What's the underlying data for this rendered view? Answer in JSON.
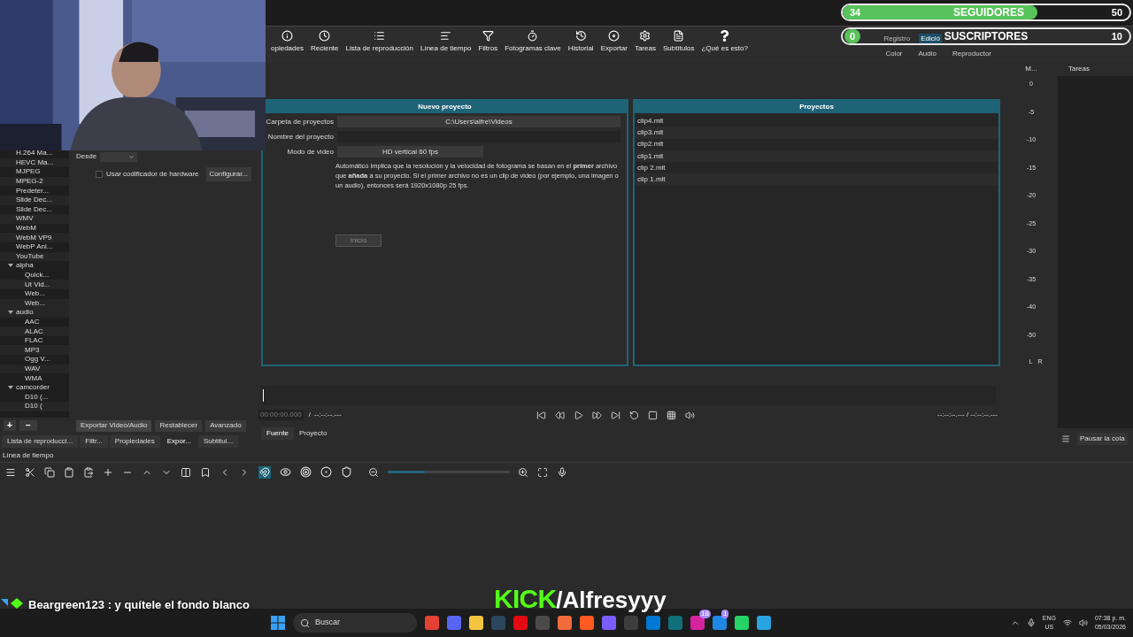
{
  "toolbar": [
    {
      "label": "opiedades"
    },
    {
      "label": "Reciente"
    },
    {
      "label": "Lista de reproducción"
    },
    {
      "label": "Línea de tiempo"
    },
    {
      "label": "Filtros"
    },
    {
      "label": "Fotogramas clave"
    },
    {
      "label": "Historial"
    },
    {
      "label": "Exportar"
    },
    {
      "label": "Tareas"
    },
    {
      "label": "Subtítulos"
    },
    {
      "label": "¿Qué es esto?"
    }
  ],
  "layouts": {
    "row1": [
      {
        "label": "Registro",
        "selected": false
      },
      {
        "label": "Edició",
        "selected": true
      }
    ],
    "row2": [
      {
        "label": "Color",
        "selected": false
      },
      {
        "label": "Audio",
        "selected": false
      },
      {
        "label": "Reproductor",
        "selected": false
      }
    ]
  },
  "export_presets": [
    {
      "label": "H.264 Ma..."
    },
    {
      "label": "HEVC Ma..."
    },
    {
      "label": "MJPEG"
    },
    {
      "label": "MPEG-2"
    },
    {
      "label": "Predeter..."
    },
    {
      "label": "Slide Dec..."
    },
    {
      "label": "Slide Dec..."
    },
    {
      "label": "WMV"
    },
    {
      "label": "WebM"
    },
    {
      "label": "WebM VP9"
    },
    {
      "label": "WebP Ani..."
    },
    {
      "label": "YouTube"
    },
    {
      "label": "alpha",
      "expanded": true,
      "children": [
        {
          "label": "Quick..."
        },
        {
          "label": "Ut Vid..."
        },
        {
          "label": "Web..."
        },
        {
          "label": "Web..."
        }
      ]
    },
    {
      "label": "audio",
      "expanded": true,
      "children": [
        {
          "label": "AAC"
        },
        {
          "label": "ALAC"
        },
        {
          "label": "FLAC"
        },
        {
          "label": "MP3"
        },
        {
          "label": "Ogg V..."
        },
        {
          "label": "WAV"
        },
        {
          "label": "WMA"
        }
      ]
    },
    {
      "label": "camcorder",
      "expanded": true,
      "children": [
        {
          "label": "D10 (..."
        },
        {
          "label": "D10 ("
        }
      ]
    }
  ],
  "export_settings": {
    "from_label": "Desde",
    "hardware_encoder": {
      "label": "Usar codificador de hardware",
      "checked": false
    },
    "configure_button": "Configurar...",
    "buttons": [
      "Exportar Video/Audio",
      "Restablecer",
      "Avanzado"
    ],
    "add": "+",
    "remove": "−"
  },
  "left_tabs": [
    {
      "label": "Lista de reproducci...",
      "selected": false
    },
    {
      "label": "Filtr...",
      "selected": false
    },
    {
      "label": "Propiedades",
      "selected": false
    },
    {
      "label": "Expor...",
      "selected": true
    },
    {
      "label": "Subtitul...",
      "selected": false
    }
  ],
  "new_project": {
    "title": "Nuevo proyecto",
    "folder_label": "Carpeta de proyectos",
    "folder": "C:\\Users\\alfre\\Videos",
    "name_label": "Nombre del proyecto",
    "mode_label": "Modo de video",
    "mode": "HD vertical 60 fps",
    "note": "Automático implica que la resolución y la velocidad de fotograma se basan en el **primer** archivo que **añada** a su proyecto. Si el primer archivo no es un clip de video (por ejemplo, una imagen o un audio), entonces será 1920x1080p 25 fps.",
    "start": {
      "label": "Inicio",
      "disabled": true
    }
  },
  "projects": {
    "title": "Proyectos",
    "items": [
      "clip4.mlt",
      "clip3.mlt",
      "clip2.mlt",
      "clip1.mlt",
      "clip 2.mlt",
      "clip 1.mlt"
    ]
  },
  "player": {
    "timecode": "00:00:00.000",
    "separator": "/",
    "duration": "--:--:--.---",
    "in_out": "--:--:--.--- / --:--:--.---",
    "tabs": [
      {
        "label": "Fuente",
        "selected": true
      },
      {
        "label": "Proyecto",
        "selected": false
      }
    ]
  },
  "meter": {
    "title": "M...",
    "scale": [
      "0",
      "-5",
      "-10",
      "-15",
      "-20",
      "-25",
      "-30",
      "-35",
      "-40",
      "-50"
    ],
    "left": "L",
    "right": "R"
  },
  "jobs": {
    "title": "Tareas",
    "pause": "Pausar la cola"
  },
  "timeline": {
    "title": "Línea de tiempo",
    "snap_on": true,
    "zoom": {
      "level": 0.31
    }
  },
  "overlay": {
    "followers": {
      "count": "34",
      "label": "SEGUIDORES",
      "goal": "50",
      "level": 0.68
    },
    "subscribers": {
      "count": "0",
      "label": "SUSCRIPTORES",
      "goal": "10",
      "level": 0
    },
    "kick": "KICK",
    "channel": "/Alfresyyy",
    "chat": {
      "user": "Beargreen123",
      "message": ": y quítele el fondo blanco"
    }
  },
  "taskbar": {
    "search": {
      "placeholder": "Buscar"
    },
    "badges": [
      "18",
      "1"
    ],
    "lang": "ENG",
    "region": "US",
    "time": "07:38 p. m.",
    "date": "05/03/2026"
  }
}
